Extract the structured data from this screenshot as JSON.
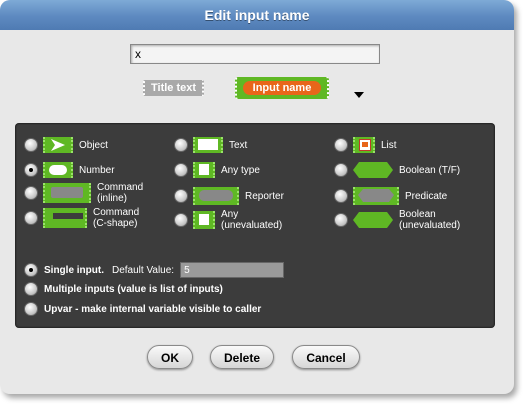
{
  "dialog": {
    "title": "Edit input name",
    "name_value": "x",
    "title_text_label": "Title text",
    "input_name_label": "Input name"
  },
  "types": [
    {
      "label": "Object",
      "selected": false
    },
    {
      "label": "Text",
      "selected": false
    },
    {
      "label": "List",
      "selected": false
    },
    {
      "label": "Number",
      "selected": true
    },
    {
      "label": "Any type",
      "selected": false
    },
    {
      "label": "Boolean (T/F)",
      "selected": false
    },
    {
      "label": "Command\n(inline)",
      "selected": false
    },
    {
      "label": "Reporter",
      "selected": false
    },
    {
      "label": "Predicate",
      "selected": false
    },
    {
      "label": "Command\n(C-shape)",
      "selected": false
    },
    {
      "label": "Any\n(unevaluated)",
      "selected": false
    },
    {
      "label": "Boolean\n(unevaluated)",
      "selected": false
    }
  ],
  "input_modes": {
    "single": {
      "label": "Single input.",
      "selected": true
    },
    "default_label": "Default Value:",
    "default_value": "5",
    "multiple": {
      "label": "Multiple inputs (value is list of inputs)",
      "selected": false
    },
    "upvar": {
      "label": "Upvar - make internal variable visible to caller",
      "selected": false
    }
  },
  "buttons": {
    "ok": "OK",
    "delete": "Delete",
    "cancel": "Cancel"
  },
  "colors": {
    "accent_green": "#5fb824",
    "input_orange": "#e8661a",
    "title_blue": "#5d89c0",
    "panel_dark": "#3c3c3c"
  }
}
